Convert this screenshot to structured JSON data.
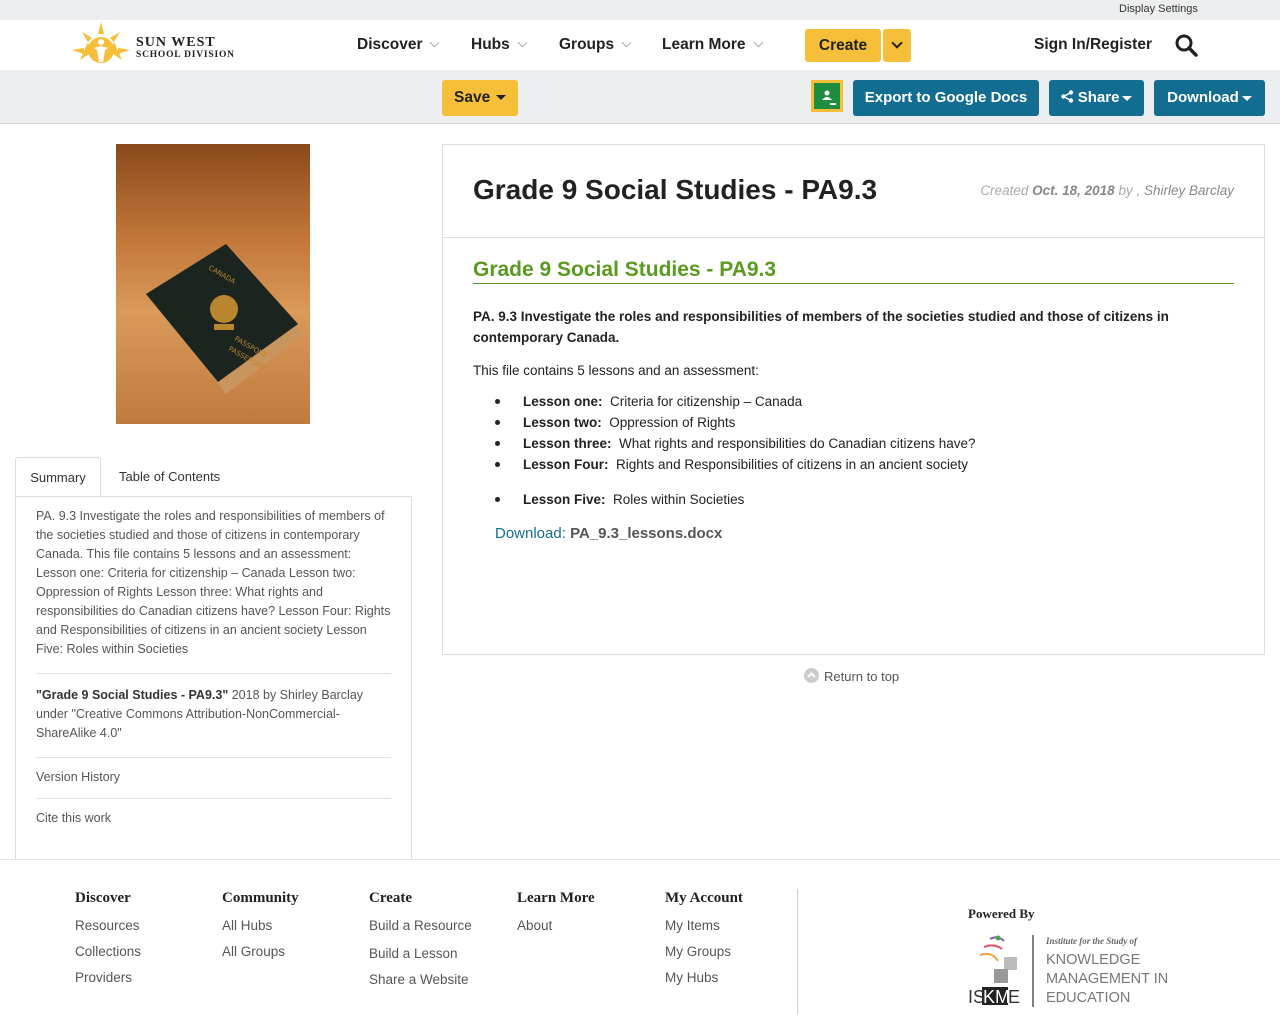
{
  "util": {
    "display_settings": "Display Settings"
  },
  "brand": {
    "line1": "SUN WEST",
    "line2": "SCHOOL DIVISION"
  },
  "nav": {
    "items": [
      "Discover",
      "Hubs",
      "Groups",
      "Learn More"
    ],
    "create": "Create",
    "signin": "Sign In/Register"
  },
  "toolbar": {
    "save": "Save",
    "export": "Export to Google Docs",
    "share": "Share",
    "download": "Download"
  },
  "resource": {
    "title": "Grade 9 Social Studies - PA9.3",
    "created_label": "Created",
    "created_date": "Oct. 18, 2018",
    "by": "by ,",
    "author": "Shirley Barclay",
    "section_title": "Grade 9 Social Studies - PA9.3",
    "objective": "PA. 9.3  Investigate the roles and responsibilities of members of the societies studied and those of citizens in contemporary Canada.",
    "intro": "This file contains 5 lessons and an assessment:",
    "lessons": [
      {
        "label": "Lesson one:",
        "text": "Criteria for citizenship – Canada"
      },
      {
        "label": "Lesson two:",
        "text": "Oppression of Rights"
      },
      {
        "label": "Lesson three:",
        "text": "What rights and responsibilities do Canadian citizens have?"
      },
      {
        "label": "Lesson Four:",
        "text": "Rights and Responsibilities of citizens in an ancient society"
      },
      {
        "label": "Lesson Five:",
        "text": "Roles within Societies"
      }
    ],
    "download_label": "Download:",
    "download_file": "PA_9.3_lessons.docx"
  },
  "sidebar": {
    "tab_summary": "Summary",
    "tab_toc": "Table of Contents",
    "summary": "PA. 9.3 Investigate the roles and responsibilities of members of the societies studied and those of citizens in contemporary Canada. This file contains 5 lessons and an assessment: Lesson one: Criteria for citizenship – Canada Lesson two: Oppression of Rights Lesson three: What rights and responsibilities do Canadian citizens have? Lesson Four: Rights and Responsibilities of citizens in an ancient society Lesson Five: Roles within Societies",
    "license_title": "\"Grade 9 Social Studies - PA9.3\"",
    "license_rest": " 2018 by Shirley Barclay under \"Creative Commons Attribution-NonCommercial-ShareAlike 4.0\"",
    "version_history": "Version History",
    "cite": "Cite this work",
    "passport_line1": "CANADA",
    "passport_line2": "PASSPORT",
    "passport_line3": "PASSEPORT"
  },
  "return_top": "Return to top",
  "footer": {
    "columns": [
      {
        "title": "Discover",
        "links": [
          "Resources",
          "Collections",
          "Providers"
        ]
      },
      {
        "title": "Community",
        "links": [
          "All Hubs",
          "All Groups"
        ]
      },
      {
        "title": "Create",
        "links": [
          "Build a Resource",
          "Build a Lesson",
          "Share a Website"
        ]
      },
      {
        "title": "Learn More",
        "links": [
          "About"
        ]
      },
      {
        "title": "My Account",
        "links": [
          "My Items",
          "My Groups",
          "My Hubs"
        ]
      }
    ],
    "powered_by": "Powered By",
    "iskme": {
      "tagline": "Institute for the Study of",
      "line1": "KNOWLEDGE",
      "line2": "MANAGEMENT IN",
      "line3": "EDUCATION",
      "abbr1": "IS",
      "abbr2": "KM",
      "abbr3": "E"
    }
  },
  "colors": {
    "accent_yellow": "#f5bf3a",
    "primary_blue": "#136d91",
    "title_green": "#5a9a1f"
  }
}
